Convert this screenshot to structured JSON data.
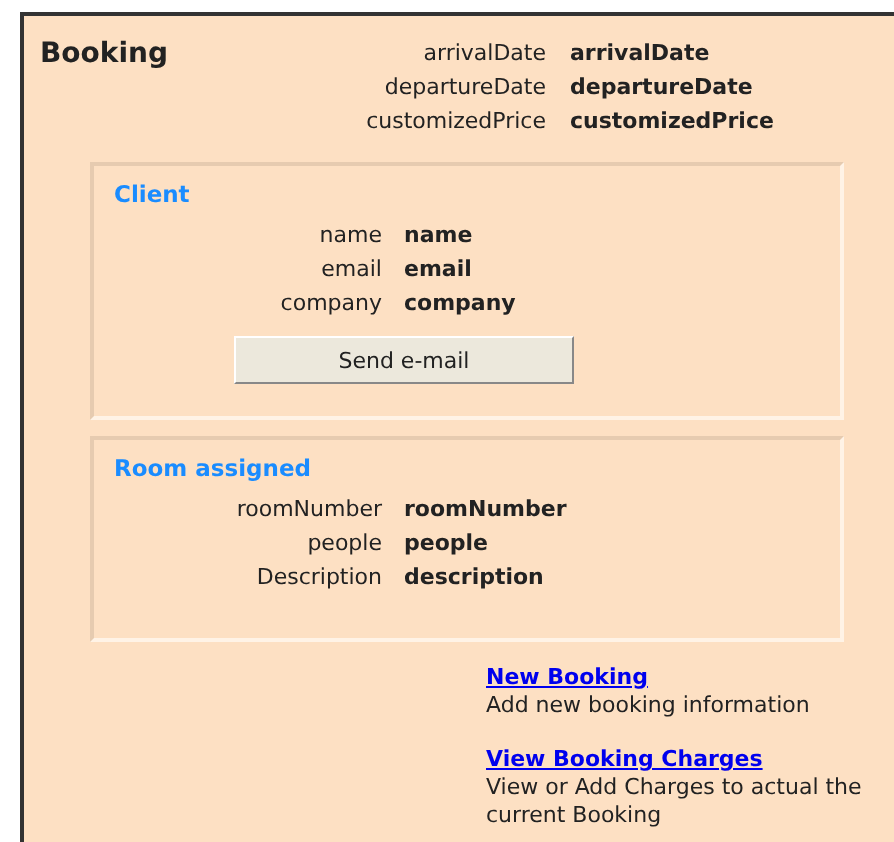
{
  "title": "Booking",
  "fields": [
    {
      "label": "arrivalDate",
      "value": "arrivalDate"
    },
    {
      "label": "departureDate",
      "value": "departureDate"
    },
    {
      "label": "customizedPrice",
      "value": "customizedPrice"
    }
  ],
  "sections": [
    {
      "title": "Client",
      "fields": [
        {
          "label": "name",
          "value": "name"
        },
        {
          "label": "email",
          "value": "email"
        },
        {
          "label": "company",
          "value": "company"
        }
      ],
      "button": "Send e-mail"
    },
    {
      "title": "Room assigned",
      "fields": [
        {
          "label": "roomNumber",
          "value": "roomNumber"
        },
        {
          "label": "people",
          "value": "people"
        },
        {
          "label": "Description",
          "value": "description"
        }
      ]
    }
  ],
  "links": [
    {
      "label": "New Booking",
      "description": "Add new booking information"
    },
    {
      "label": "View Booking Charges",
      "description": "View or Add Charges to actual the current Booking"
    }
  ]
}
